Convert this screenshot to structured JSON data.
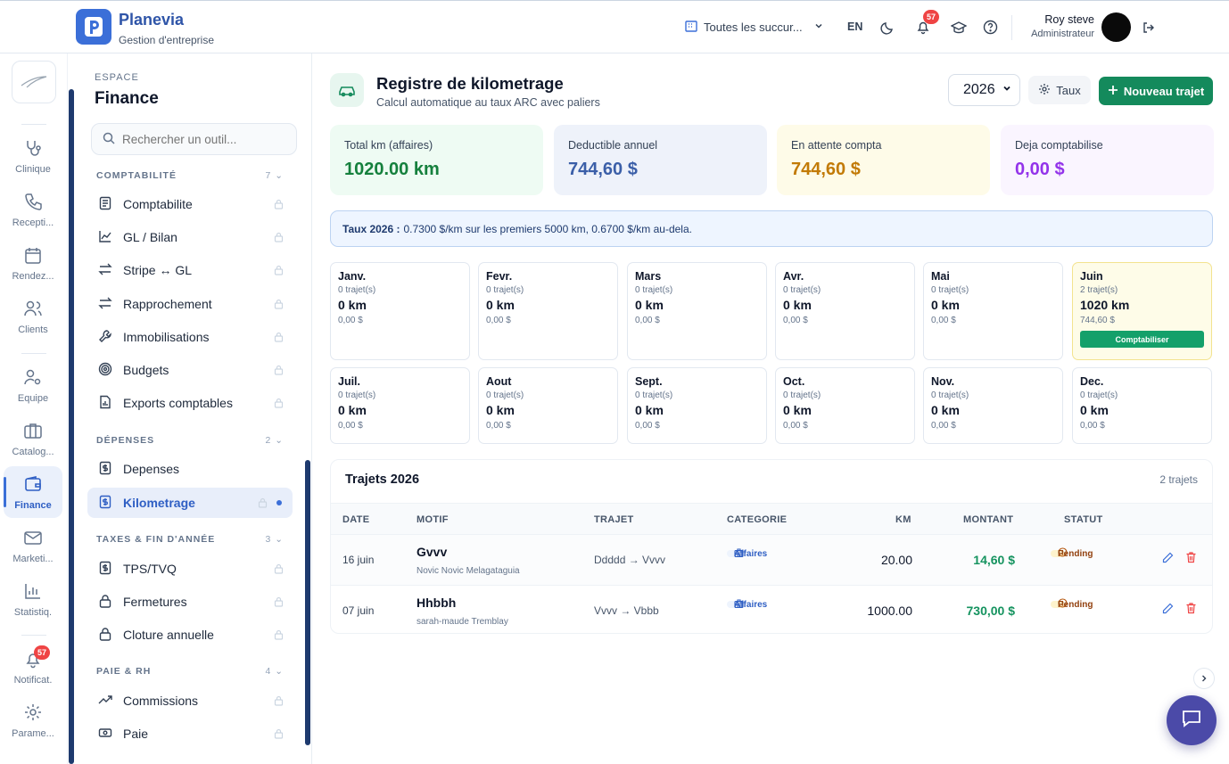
{
  "brand": {
    "name": "Planevia",
    "subtitle": "Gestion d'entreprise"
  },
  "topbar": {
    "branch_selector": "Toutes les succur...",
    "language": "EN",
    "notification_count": "57",
    "user_name": "Roy steve",
    "user_role": "Administrateur"
  },
  "rail": {
    "items": [
      {
        "label": "Clinique",
        "icon": "stethoscope-icon"
      },
      {
        "label": "Recepti...",
        "icon": "phone-icon"
      },
      {
        "label": "Rendez...",
        "icon": "calendar-icon"
      },
      {
        "label": "Clients",
        "icon": "users-icon"
      },
      {
        "label": "Equipe",
        "icon": "user-gear-icon"
      },
      {
        "label": "Catalog...",
        "icon": "briefcase-icon"
      },
      {
        "label": "Finance",
        "icon": "wallet-icon"
      },
      {
        "label": "Marketi...",
        "icon": "mail-icon"
      },
      {
        "label": "Statistiq.",
        "icon": "bar-chart-icon"
      },
      {
        "label": "Notificat.",
        "icon": "bell-icon"
      },
      {
        "label": "Parame...",
        "icon": "gear-icon"
      }
    ],
    "notification_badge": "57"
  },
  "panel": {
    "espace": "ESPACE",
    "title": "Finance",
    "search_placeholder": "Rechercher un outil...",
    "sections": [
      {
        "title": "COMPTABILITÉ",
        "count": "7"
      },
      {
        "title": "DÉPENSES",
        "count": "2"
      },
      {
        "title": "TAXES & FIN D'ANNÉE",
        "count": "3"
      },
      {
        "title": "PAIE & RH",
        "count": "4"
      }
    ],
    "items": [
      {
        "label": "Comptabilite",
        "icon": "ledger-icon"
      },
      {
        "label": "GL / Bilan",
        "icon": "chart-line-icon"
      },
      {
        "label": "Stripe ↔ GL",
        "icon": "swap-icon"
      },
      {
        "label": "Rapprochement",
        "icon": "swap-icon"
      },
      {
        "label": "Immobilisations",
        "icon": "wrench-icon"
      },
      {
        "label": "Budgets",
        "icon": "target-icon"
      },
      {
        "label": "Exports comptables",
        "icon": "file-chart-icon"
      },
      {
        "label": "Depenses",
        "icon": "dollar-doc-icon"
      },
      {
        "label": "Kilometrage",
        "icon": "dollar-doc-icon"
      },
      {
        "label": "TPS/TVQ",
        "icon": "dollar-doc-icon"
      },
      {
        "label": "Fermetures",
        "icon": "lock-icon"
      },
      {
        "label": "Cloture annuelle",
        "icon": "lock-icon"
      },
      {
        "label": "Commissions",
        "icon": "trend-up-icon"
      },
      {
        "label": "Paie",
        "icon": "banknote-icon"
      }
    ]
  },
  "main": {
    "title": "Registre de kilometrage",
    "subtitle": "Calcul automatique au taux ARC avec paliers",
    "year": "2026",
    "taux_label": "Taux",
    "new_trip_label": "Nouveau trajet",
    "stats": [
      {
        "label": "Total km (affaires)",
        "value": "1020.00 km",
        "bg": "#eefbf3",
        "color": "#15803d"
      },
      {
        "label": "Deductible annuel",
        "value": "744,60 $",
        "bg": "#eef2fa",
        "color": "#3b5fa8"
      },
      {
        "label": "En attente compta",
        "value": "744,60 $",
        "bg": "#fefbe8",
        "color": "#c27a06"
      },
      {
        "label": "Deja comptabilise",
        "value": "0,00 $",
        "bg": "#faf5ff",
        "color": "#9333ea"
      }
    ],
    "rate_bold": "Taux 2026 :",
    "rate_text": "0.7300 $/km sur les premiers 5000 km, 0.6700 $/km au-dela.",
    "months": [
      {
        "name": "Janv.",
        "trips": "0 trajet(s)",
        "km": "0 km",
        "amount": "0,00 $"
      },
      {
        "name": "Fevr.",
        "trips": "0 trajet(s)",
        "km": "0 km",
        "amount": "0,00 $"
      },
      {
        "name": "Mars",
        "trips": "0 trajet(s)",
        "km": "0 km",
        "amount": "0,00 $"
      },
      {
        "name": "Avr.",
        "trips": "0 trajet(s)",
        "km": "0 km",
        "amount": "0,00 $"
      },
      {
        "name": "Mai",
        "trips": "0 trajet(s)",
        "km": "0 km",
        "amount": "0,00 $"
      },
      {
        "name": "Juin",
        "trips": "2 trajet(s)",
        "km": "1020 km",
        "amount": "744,60 $",
        "action": "Comptabiliser"
      },
      {
        "name": "Juil.",
        "trips": "0 trajet(s)",
        "km": "0 km",
        "amount": "0,00 $"
      },
      {
        "name": "Aout",
        "trips": "0 trajet(s)",
        "km": "0 km",
        "amount": "0,00 $"
      },
      {
        "name": "Sept.",
        "trips": "0 trajet(s)",
        "km": "0 km",
        "amount": "0,00 $"
      },
      {
        "name": "Oct.",
        "trips": "0 trajet(s)",
        "km": "0 km",
        "amount": "0,00 $"
      },
      {
        "name": "Nov.",
        "trips": "0 trajet(s)",
        "km": "0 km",
        "amount": "0,00 $"
      },
      {
        "name": "Dec.",
        "trips": "0 trajet(s)",
        "km": "0 km",
        "amount": "0,00 $"
      }
    ],
    "table": {
      "title": "Trajets 2026",
      "count": "2 trajets",
      "headers": {
        "date": "DATE",
        "motif": "MOTIF",
        "trajet": "TRAJET",
        "categorie": "CATEGORIE",
        "km": "KM",
        "montant": "MONTANT",
        "statut": "STATUT"
      },
      "rows": [
        {
          "date": "16 juin",
          "motif": "Gvvv",
          "person": "Novic Novic Melagataguia",
          "trajet": "Ddddd → Vvvv",
          "categorie": "Affaires",
          "km": "20.00",
          "montant": "14,60 $",
          "statut": "Pending"
        },
        {
          "date": "07 juin",
          "motif": "Hhbbh",
          "person": "sarah-maude Tremblay",
          "trajet": "Vvvv → Vbbb",
          "categorie": "Affaires",
          "km": "1000.00",
          "montant": "730,00 $",
          "statut": "Pending"
        }
      ]
    }
  }
}
